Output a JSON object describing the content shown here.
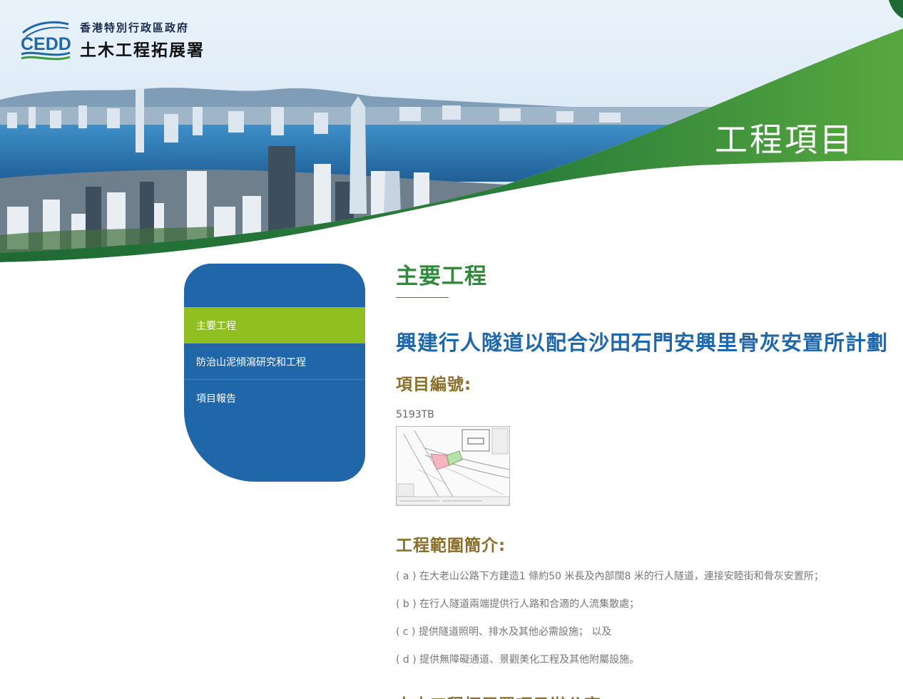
{
  "header": {
    "logo_abbr": "CEDD",
    "logo_line1": "香港特別行政區政府",
    "logo_line2": "土木工程拓展署",
    "banner_title": "工程項目"
  },
  "sidebar": {
    "items": [
      {
        "label": "主要工程",
        "active": true
      },
      {
        "label": "防治山泥傾瀉研究和工程",
        "active": false
      },
      {
        "label": "項目報告",
        "active": false
      }
    ]
  },
  "main": {
    "page_heading": "主要工程",
    "project_title": "興建行人隧道以配合沙田石門安興里骨灰安置所計劃",
    "project_code_heading": "項目編號:",
    "project_code": "5193TB",
    "scope_heading": "工程範圍簡介:",
    "scope_items": [
      "( a ) 在大老山公路下方建造1 條約50 米長及內部闊8 米的行人隧道，連接安睦街和骨灰安置所；",
      "( b ) 在行人隧道兩端提供行人路和合適的人流集散處；",
      "( c ) 提供隧道照明、排水及其他必需設施； 以及",
      "( d ) 提供無障礙通道、景觀美化工程及其他附屬設施。"
    ],
    "office_heading": "土木工程拓展署項目辦公室:"
  },
  "colors": {
    "green_heading": "#2f8a3a",
    "blue_title": "#1f67a8",
    "gold_heading": "#8a6f2a",
    "sidebar_bg": "#1f67a8",
    "sidebar_active": "#8fbf21"
  }
}
